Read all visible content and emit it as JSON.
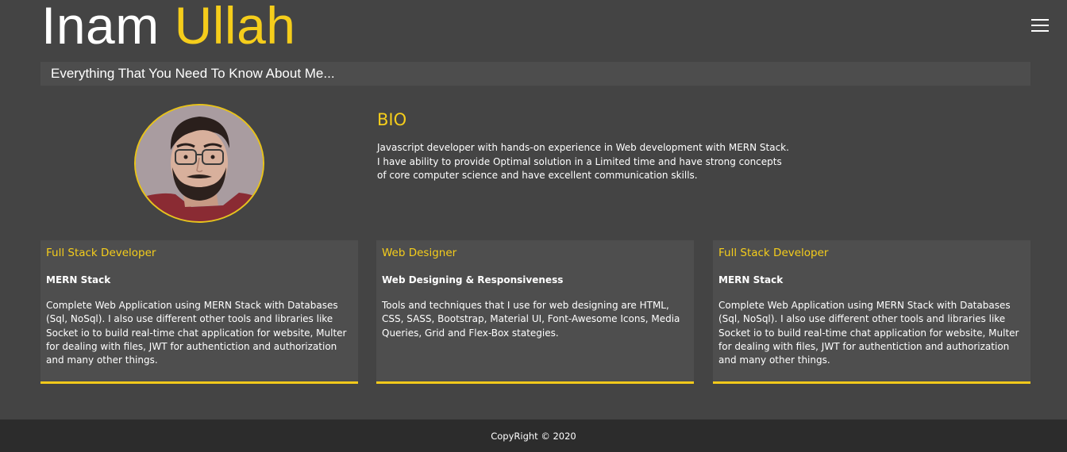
{
  "header": {
    "name_first": "Inam",
    "name_last": "Ullah",
    "menu_icon": "hamburger-menu-icon",
    "tagline": "Everything That You Need To Know About Me..."
  },
  "profile": {
    "avatar": "profile-photo"
  },
  "bio": {
    "heading": "BIO",
    "text": "Javascript developer with hands-on experience in Web development with MERN Stack. I have ability to provide Optimal solution in a Limited time and have strong concepts of core computer science and have excellent communication skills."
  },
  "cards": [
    {
      "title": "Full Stack Developer",
      "subtitle": "MERN Stack",
      "text": "Complete Web Application using MERN Stack with Databases (Sql, NoSql). I also use different other tools and libraries like Socket io to build real-time chat application for website, Multer for dealing with files, JWT for authentiction and authorization and many other things."
    },
    {
      "title": "Web Designer",
      "subtitle": "Web Designing & Responsiveness",
      "text": "Tools and techniques that I use for web designing are HTML, CSS, SASS, Bootstrap, Material UI, Font-Awesome Icons, Media Queries, Grid and Flex-Box stategies."
    },
    {
      "title": "Full Stack Developer",
      "subtitle": "MERN Stack",
      "text": "Complete Web Application using MERN Stack with Databases (Sql, NoSql). I also use different other tools and libraries like Socket io to build real-time chat application for website, Multer for dealing with files, JWT for authentiction and authorization and many other things."
    }
  ],
  "footer": {
    "copyright": "CopyRight © 2020"
  },
  "colors": {
    "background": "#444444",
    "accent": "#f5cd1b",
    "card": "#4e4e4e",
    "footer": "#2c2c2c"
  }
}
